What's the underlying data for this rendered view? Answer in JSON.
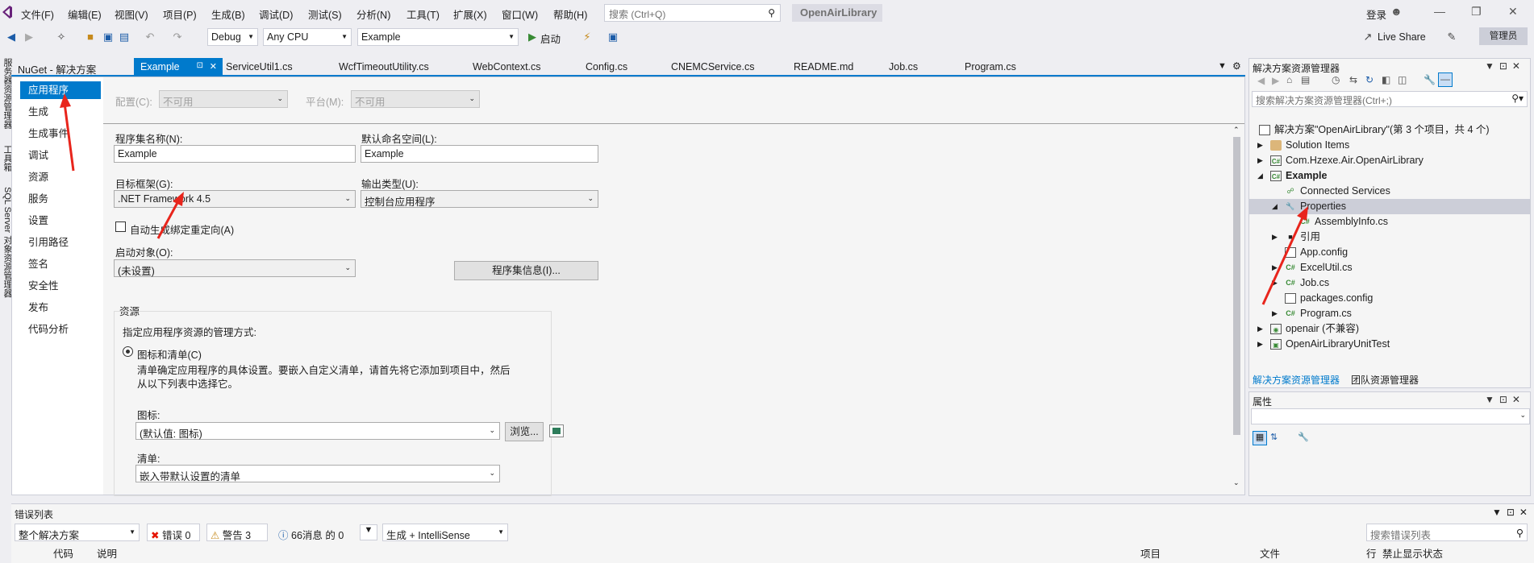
{
  "menubar": {
    "items": [
      "文件(F)",
      "编辑(E)",
      "视图(V)",
      "项目(P)",
      "生成(B)",
      "调试(D)",
      "测试(S)",
      "分析(N)",
      "工具(T)",
      "扩展(X)",
      "窗口(W)",
      "帮助(H)"
    ],
    "search_placeholder": "搜索 (Ctrl+Q)",
    "solution_name": "OpenAirLibrary",
    "login": "登录"
  },
  "toolbar": {
    "config": "Debug",
    "platform": "Any CPU",
    "startup_project": "Example",
    "start_label": "启动",
    "live_share": "Live Share",
    "admin": "管理员"
  },
  "left_strip": {
    "items": [
      "服务器资源管理器",
      "工具箱",
      "SQL Server 对象资源管理器"
    ]
  },
  "doc_tabs": [
    {
      "label": "NuGet - 解决方案",
      "active": false
    },
    {
      "label": "Example",
      "active": true
    },
    {
      "label": "ServiceUtil1.cs",
      "active": false
    },
    {
      "label": "WcfTimeoutUtility.cs",
      "active": false
    },
    {
      "label": "WebContext.cs",
      "active": false
    },
    {
      "label": "Config.cs",
      "active": false
    },
    {
      "label": "CNEMCService.cs",
      "active": false
    },
    {
      "label": "README.md",
      "active": false
    },
    {
      "label": "Job.cs",
      "active": false
    },
    {
      "label": "Program.cs",
      "active": false
    }
  ],
  "prop_nav": {
    "items": [
      "应用程序",
      "生成",
      "生成事件",
      "调试",
      "资源",
      "服务",
      "设置",
      "引用路径",
      "签名",
      "安全性",
      "发布",
      "代码分析"
    ]
  },
  "prop_page": {
    "config_label": "配置(C):",
    "config_value": "不可用",
    "platform_label": "平台(M):",
    "platform_value": "不可用",
    "assembly_name_label": "程序集名称(N):",
    "assembly_name": "Example",
    "default_ns_label": "默认命名空间(L):",
    "default_ns": "Example",
    "target_fw_label": "目标框架(G):",
    "target_fw": ".NET Framework 4.5",
    "output_type_label": "输出类型(U):",
    "output_type": "控制台应用程序",
    "auto_binding": "自动生成绑定重定向(A)",
    "startup_obj_label": "启动对象(O):",
    "startup_obj": "(未设置)",
    "assembly_info_btn": "程序集信息(I)...",
    "resources_title": "资源",
    "resources_desc": "指定应用程序资源的管理方式:",
    "icon_manifest_radio": "图标和清单(C)",
    "icon_manifest_desc": "清单确定应用程序的具体设置。要嵌入自定义清单，请首先将它添加到项目中，然后从以下列表中选择它。",
    "icon_label": "图标:",
    "icon_value": "(默认值: 图标)",
    "browse_btn": "浏览...",
    "manifest_label": "清单:",
    "manifest_value": "嵌入带默认设置的清单"
  },
  "solution_explorer": {
    "title": "解决方案资源管理器",
    "search_placeholder": "搜索解决方案资源管理器(Ctrl+;)",
    "items": [
      {
        "label": "解决方案\"OpenAirLibrary\"(第 3 个项目，共 4 个)",
        "bold": false
      },
      {
        "label": "Solution Items",
        "bold": false
      },
      {
        "label": "Com.Hzexe.Air.OpenAirLibrary",
        "bold": false
      },
      {
        "label": "Example",
        "bold": true
      },
      {
        "label": "Connected Services",
        "bold": false
      },
      {
        "label": "Properties",
        "bold": false
      },
      {
        "label": "AssemblyInfo.cs",
        "bold": false
      },
      {
        "label": "引用",
        "bold": false
      },
      {
        "label": "App.config",
        "bold": false
      },
      {
        "label": "ExcelUtil.cs",
        "bold": false
      },
      {
        "label": "Job.cs",
        "bold": false
      },
      {
        "label": "packages.config",
        "bold": false
      },
      {
        "label": "Program.cs",
        "bold": false
      },
      {
        "label": "openair (不兼容)",
        "bold": false
      },
      {
        "label": "OpenAirLibraryUnitTest",
        "bold": false
      }
    ],
    "tab_solution": "解决方案资源管理器",
    "tab_team": "团队资源管理器"
  },
  "properties_panel": {
    "title": "属性"
  },
  "error_list": {
    "title": "错误列表",
    "scope": "整个解决方案",
    "errors": "错误 0",
    "warnings": "警告 3",
    "messages": "66消息 的 0",
    "build_filter": "生成 + IntelliSense",
    "search_placeholder": "搜索错误列表",
    "col_code": "代码",
    "col_desc": "说明",
    "col_project": "项目",
    "col_file": "文件",
    "col_line": "行",
    "col_suppress": "禁止显示状态"
  },
  "colors": {
    "accent": "#007acc",
    "annotation_red": "#e8251c"
  }
}
